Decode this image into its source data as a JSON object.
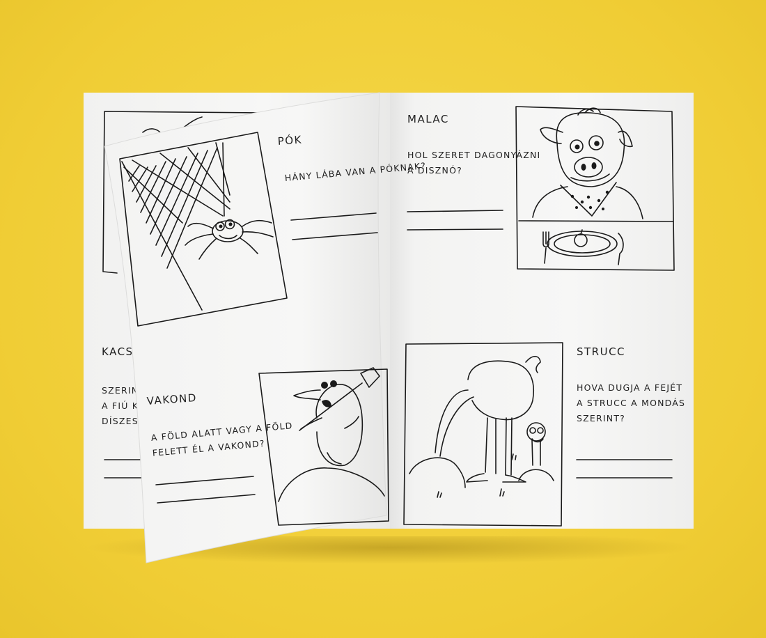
{
  "book": {
    "right_page": {
      "malac": {
        "title": "MALAC",
        "question_lines": [
          "HOL SZERET DAGONYÁZNI",
          "A DISZNÓ?"
        ]
      },
      "strucc": {
        "title": "STRUCC",
        "question_lines": [
          "HOVA DUGJA A FEJÉT",
          "A STRUCC A MONDÁS",
          "SZERINT?"
        ]
      }
    },
    "left_page_under": {
      "kacsa": {
        "title_partial": "KACS",
        "question_partial": [
          "SZERIN",
          "A FIÚ K",
          "DÍSZESEL"
        ]
      }
    },
    "turning_page": {
      "pok": {
        "title": "PÓK",
        "question_lines": [
          "HÁNY LÁBA VAN A PÓKNAK?"
        ]
      },
      "vakond": {
        "title": "VAKOND",
        "question_lines": [
          "A FÖLD ALATT VAGY A FÖLD",
          "FELETT ÉL A VAKOND?"
        ]
      }
    }
  },
  "colors": {
    "background": "#f2d13d",
    "paper": "#f4f4f3",
    "ink": "#1a1a1a"
  }
}
